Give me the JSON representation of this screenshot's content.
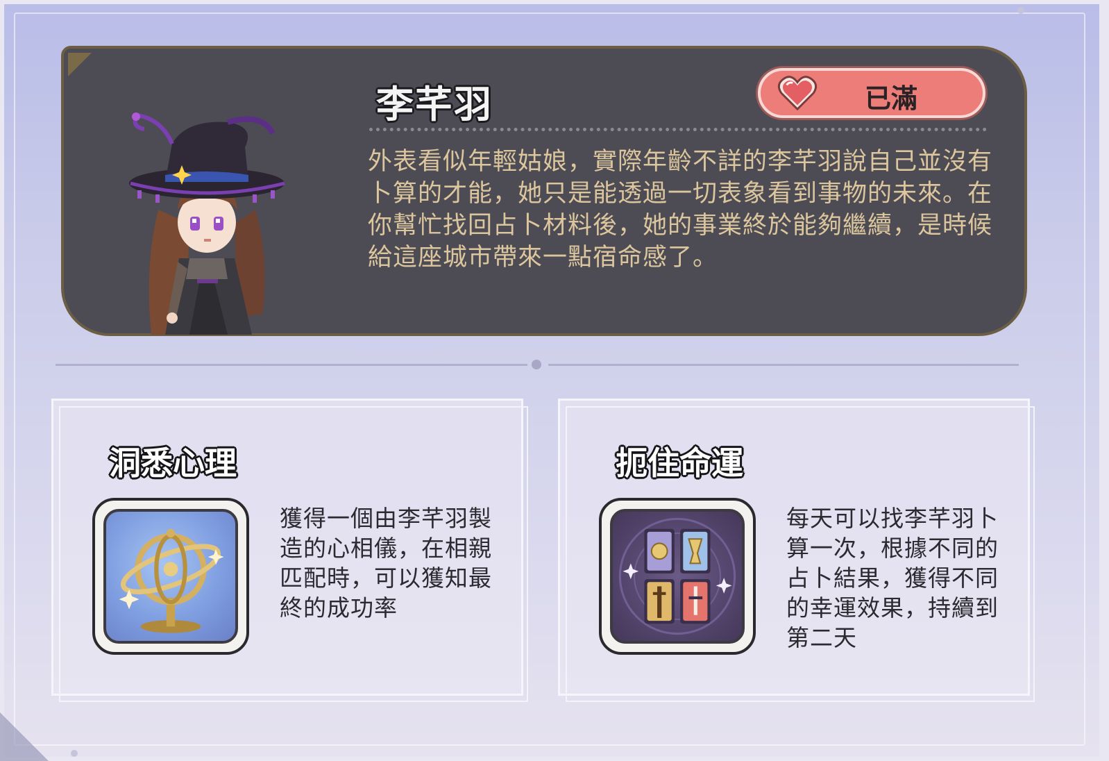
{
  "character": {
    "name": "李芊羽",
    "affinity_status": "已滿",
    "description": "外表看似年輕姑娘，實際年齡不詳的李芊羽說自己並沒有卜算的才能，她只是能透過一切表象看到事物的未來。在你幫忙找回占卜材料後，她的事業終於能夠繼續，是時候給這座城市帶來一點宿命感了。"
  },
  "skills": [
    {
      "title": "洞悉心理",
      "icon": "armillary-sphere-icon",
      "description": "獲得一個由李芊羽製造的心相儀，在相親匹配時，可以獲知最終的成功率"
    },
    {
      "title": "扼住命運",
      "icon": "tarot-cards-icon",
      "description": "每天可以找李芊羽卜算一次，根據不同的占卜結果，獲得不同的幸運效果，持續到第二天"
    }
  ],
  "colors": {
    "card_bg": "#4d4c54",
    "card_border": "#6b5e44",
    "affinity_badge": "#ec7d78",
    "description_text": "#dcc69e"
  }
}
